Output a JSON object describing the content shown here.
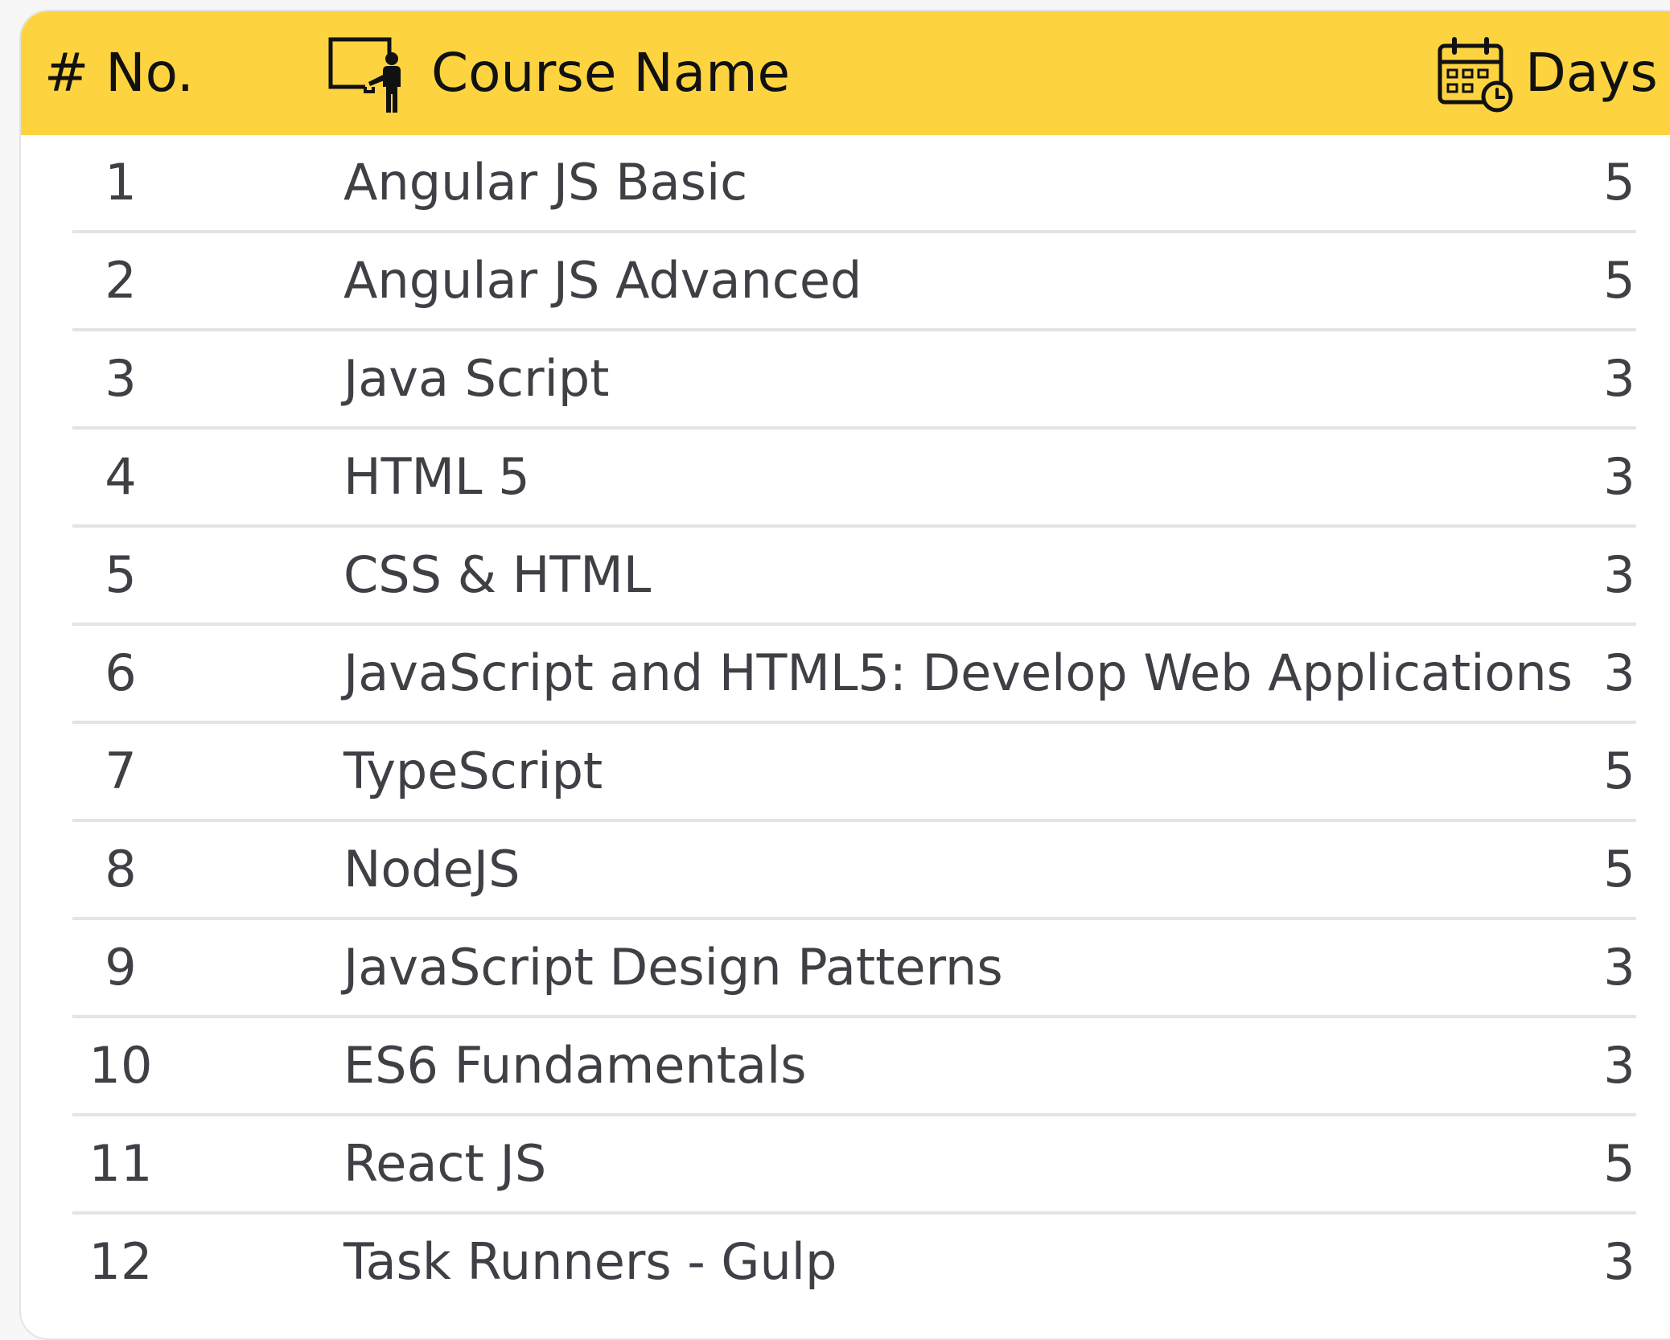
{
  "header": {
    "no_label": "# No.",
    "course_label": "Course Name",
    "days_label": "Days",
    "course_icon": "teacher-at-board-icon",
    "days_icon": "calendar-clock-icon",
    "background_color": "#fdd340"
  },
  "rows": [
    {
      "no": "1",
      "name": "Angular JS Basic",
      "days": "5"
    },
    {
      "no": "2",
      "name": "Angular JS Advanced",
      "days": "5"
    },
    {
      "no": "3",
      "name": "Java Script",
      "days": "3"
    },
    {
      "no": "4",
      "name": "HTML 5",
      "days": "3"
    },
    {
      "no": "5",
      "name": "CSS & HTML",
      "days": "3"
    },
    {
      "no": "6",
      "name": "JavaScript and HTML5: Develop Web Applications",
      "days": "3"
    },
    {
      "no": "7",
      "name": "TypeScript",
      "days": "5"
    },
    {
      "no": "8",
      "name": "NodeJS",
      "days": "5"
    },
    {
      "no": "9",
      "name": "JavaScript Design Patterns",
      "days": "3"
    },
    {
      "no": "10",
      "name": "ES6 Fundamentals",
      "days": "3"
    },
    {
      "no": "11",
      "name": "React JS",
      "days": "5"
    },
    {
      "no": "12",
      "name": "Task Runners - Gulp",
      "days": "3"
    }
  ]
}
